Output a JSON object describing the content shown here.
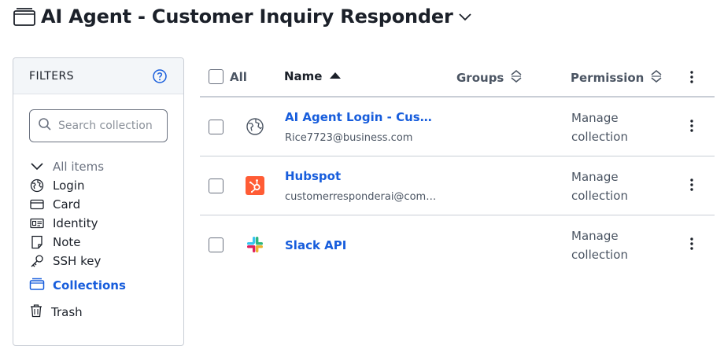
{
  "header": {
    "title": "AI Agent - Customer Inquiry Responder"
  },
  "filters": {
    "title": "FILTERS",
    "search_placeholder": "Search collection",
    "types": [
      {
        "label": "All items",
        "icon": "chevron-down-icon"
      },
      {
        "label": "Login",
        "icon": "globe-icon"
      },
      {
        "label": "Card",
        "icon": "credit-card-icon"
      },
      {
        "label": "Identity",
        "icon": "id-card-icon"
      },
      {
        "label": "Note",
        "icon": "note-icon"
      },
      {
        "label": "SSH key",
        "icon": "key-icon"
      }
    ],
    "collections_label": "Collections",
    "trash_label": "Trash"
  },
  "table": {
    "columns": {
      "all": "All",
      "name": "Name",
      "groups": "Groups",
      "permission": "Permission"
    },
    "rows": [
      {
        "name": "AI Agent Login - Customer Inquiry Responder",
        "subtitle": "Rice7723@business.com",
        "permission_line1": "Manage",
        "permission_line2": "collection",
        "icon": "globe-icon"
      },
      {
        "name": "Hubspot",
        "subtitle": "customerresponderai@company.com",
        "permission_line1": "Manage",
        "permission_line2": "collection",
        "icon": "hubspot-icon"
      },
      {
        "name": "Slack API",
        "subtitle": "",
        "permission_line1": "Manage",
        "permission_line2": "collection",
        "icon": "slack-icon"
      }
    ]
  },
  "colors": {
    "accent": "#175ddc",
    "hubspot": "#ff5c35",
    "text": "#1b2029",
    "muted": "#4b5563"
  }
}
